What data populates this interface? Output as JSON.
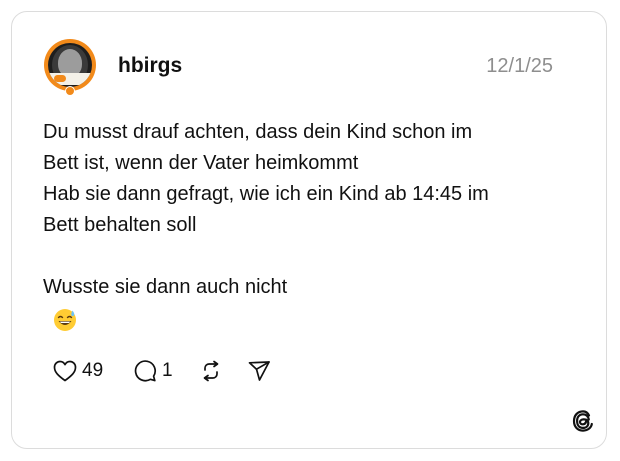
{
  "post": {
    "username": "hbirgs",
    "date": "12/1/25",
    "text": "Du musst drauf achten, dass dein Kind schon im\nBett ist, wenn der Vater heimkommt\nHab sie dann gefragt, wie ich ein Kind ab 14:45 im\nBett behalten soll\n\nWusste sie dann auch nicht",
    "emoji": "grinning-face-with-sweat-emoji"
  },
  "actions": {
    "likes": "49",
    "replies": "1",
    "icons": [
      "heart-icon",
      "comment-icon",
      "repost-icon",
      "share-icon"
    ]
  },
  "branding": {
    "logo": "threads-logo-icon"
  },
  "colors": {
    "avatar_ring": "#f28a1a",
    "date_text": "#8e8e8e",
    "border": "#dcdcdc"
  }
}
